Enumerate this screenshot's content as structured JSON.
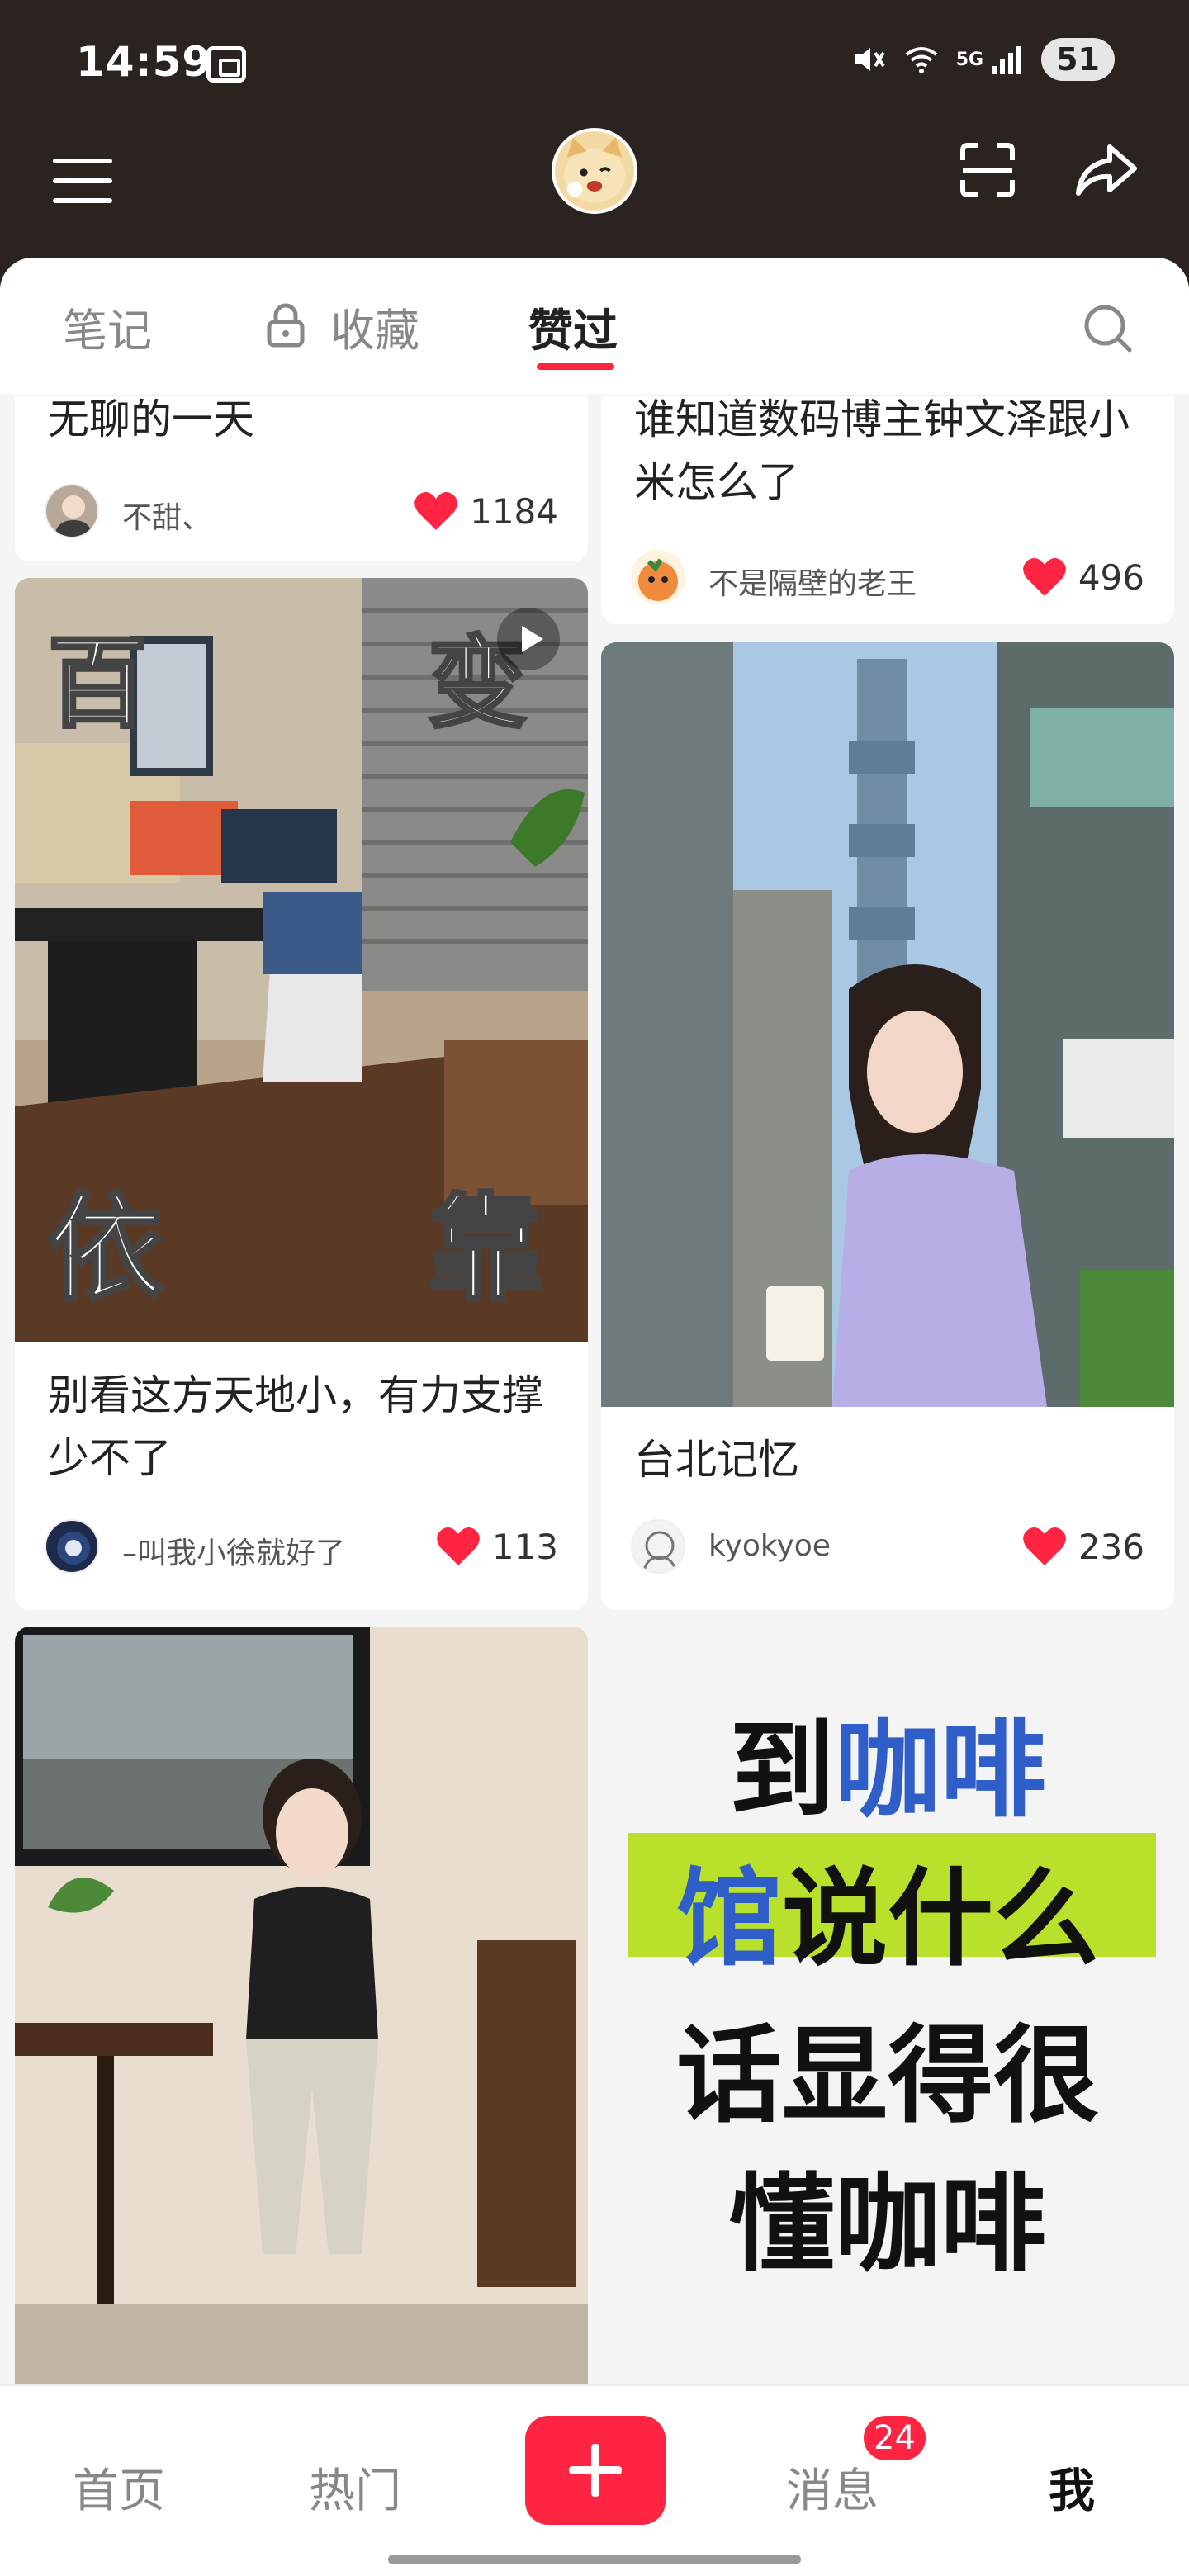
{
  "status_bar": {
    "time": "14:59",
    "network": "5G",
    "battery": "51"
  },
  "header": {
    "menu_icon": "menu-icon",
    "scan_icon": "scan-icon",
    "share_icon": "share-icon"
  },
  "tabs": {
    "notes": "笔记",
    "collect": "收藏",
    "liked": "赞过"
  },
  "feed": {
    "card1": {
      "title": "无聊的一天",
      "author": "不甜、",
      "likes": "1184"
    },
    "card2": {
      "title": "谁知道数码博主钟文泽跟小米怎么了",
      "author": "不是隔壁的老王",
      "likes": "496"
    },
    "card3": {
      "title": "别看这方天地小，有力支撑少不了",
      "author": "–叫我小徐就好了",
      "likes": "113",
      "overlay_top_left": "百",
      "overlay_top_right": "变",
      "overlay_bottom_left": "依",
      "overlay_bottom_right": "靠"
    },
    "card4": {
      "title": "台北记忆",
      "author": "kyokyoe",
      "likes": "236"
    },
    "card6": {
      "line1a": "到",
      "line1b": "咖啡",
      "line2a": "馆",
      "line2b": "说什么",
      "line3": "话显得很",
      "line4": "懂咖啡"
    }
  },
  "bottom_nav": {
    "home": "首页",
    "hot": "热门",
    "messages": "消息",
    "messages_badge": "24",
    "me": "我"
  },
  "colors": {
    "accent": "#ff2442",
    "header_bg": "#2a2320"
  }
}
